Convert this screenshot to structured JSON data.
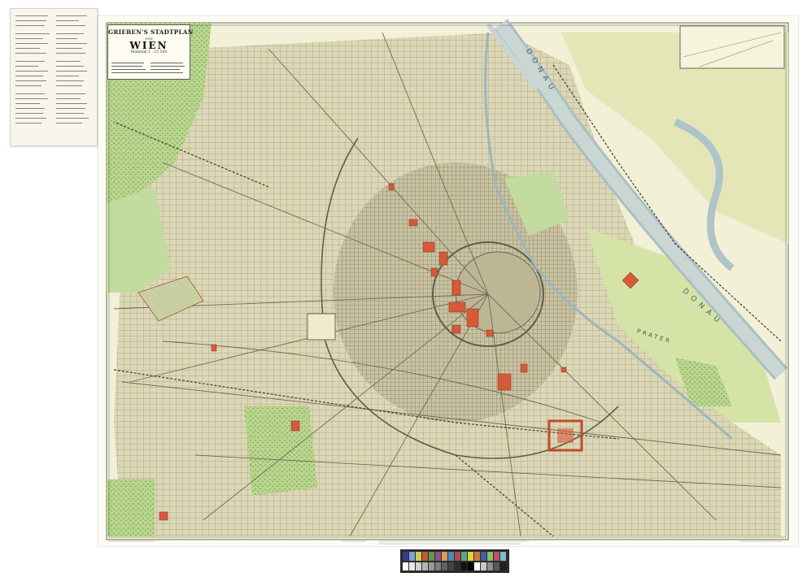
{
  "map": {
    "title": "GRIEBEN'S STADTPLAN",
    "von": "VON",
    "city": "WIEN",
    "scale": "Maßstab 1 : 15 500"
  },
  "labels": {
    "donau_upper": "DONAU",
    "donau_lower": "DONAU",
    "prater": "PRATER"
  },
  "colors": {
    "paper": "#fdfcf4",
    "built_area": "#d8d3b0",
    "park_green": "#b8d28c",
    "forest_green": "#9cc46e",
    "water": "#c9d6d3",
    "public_building": "#d65a3a",
    "street": "#6b6b5c"
  },
  "calibration": {
    "patch_colors": [
      "#3a3a8c",
      "#7aa4d8",
      "#d4c85a",
      "#c2563a",
      "#5e9a4c",
      "#9a4c86",
      "#d8a050",
      "#4c8ab8",
      "#b8484c",
      "#58a890",
      "#e0d040",
      "#cc7a3a",
      "#485aa0",
      "#8cc060",
      "#c04a7a",
      "#78c0c8"
    ],
    "gray_steps": [
      "#ffffff",
      "#e8e8e8",
      "#d0d0d0",
      "#b4b4b4",
      "#989898",
      "#7c7c7c",
      "#606060",
      "#444444",
      "#2c2c2c",
      "#141414",
      "#000000",
      "#ffffff",
      "#c8c8c8",
      "#909090",
      "#585858",
      "#202020"
    ]
  }
}
